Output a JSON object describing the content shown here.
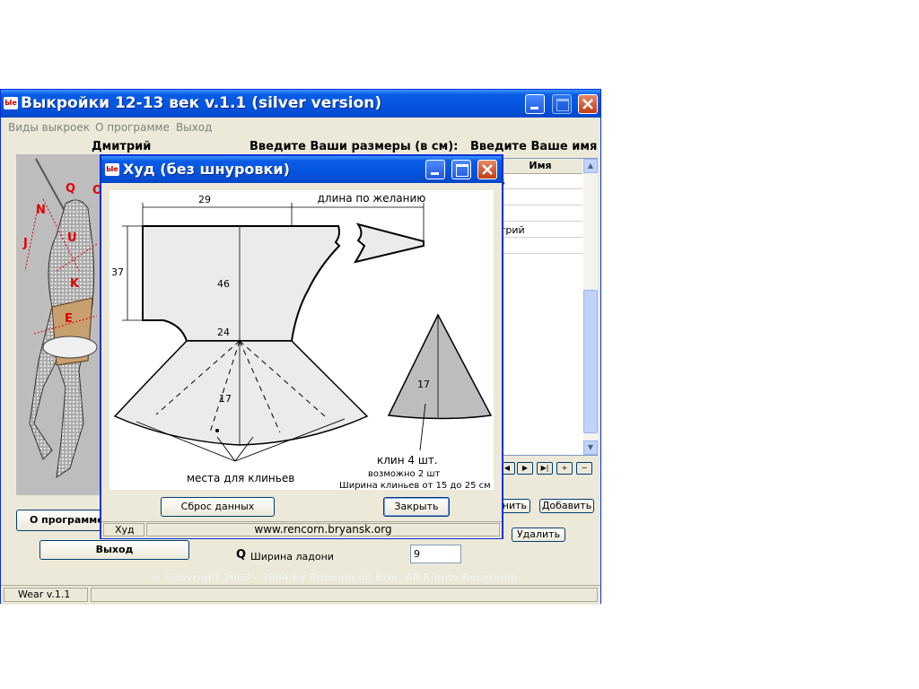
{
  "window": {
    "title": "Выкройки 12-13 век v.1.1 (silver version)",
    "icon_text": "Ыe",
    "menu": [
      "Виды выкроек",
      "О программе",
      "Выход"
    ]
  },
  "header": {
    "name_label": "Дмитрий",
    "sizes_label": "Введите Ваши размеры (в см):",
    "enter_name_label": "Введите Ваше имя"
  },
  "figure_labels": [
    "Q",
    "O",
    "N",
    "J",
    "U",
    "K",
    "E"
  ],
  "table": {
    "column": "Имя",
    "rows": [
      "s",
      "",
      "",
      "трий",
      ""
    ]
  },
  "nav_buttons": [
    "◀",
    "▶",
    "▶|",
    "+",
    "−"
  ],
  "buttons": {
    "about": "О программе",
    "exit": "Выход",
    "save": "нить",
    "add": "Добавить",
    "delete": "Удалить"
  },
  "measure": {
    "letter": "Q",
    "label": "Ширина ладони",
    "value": "9"
  },
  "copyright": "© Copyright 2003 - 2004 by Rendom de Brie. All Rights Reserved.",
  "status": {
    "version": "Wear v.1.1"
  },
  "dialog": {
    "title": "Худ (без шнуровки)",
    "icon_text": "Ыe",
    "reset_button": "Сброс данных",
    "close_button": "Закрыть",
    "status_item": "Худ",
    "status_url": "www.rencorn.bryansk.org",
    "drawing": {
      "dim_top": "29",
      "length_note": "длина по желанию",
      "dim_left": "37",
      "dim_center": "46",
      "dim_waist": "24",
      "dim_skirt": "17",
      "dim_gore": "17",
      "gore_places": "места для клиньев",
      "gore_count": "клин 4 шт.",
      "gore_alt": "возможно 2 шт",
      "gore_width": "Ширина клиньев от 15 до 25 см"
    }
  }
}
